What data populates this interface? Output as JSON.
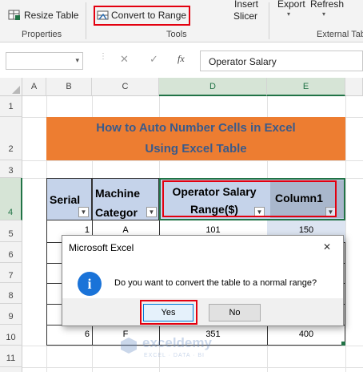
{
  "ribbon": {
    "resize_table": "Resize Table",
    "convert_to_range": "Convert to Range",
    "insert": "Insert",
    "slicer": "Slicer",
    "export": "Export",
    "refresh": "Refresh",
    "group_properties": "Properties",
    "group_tools": "Tools",
    "group_external": "External Tab"
  },
  "formula_bar": {
    "name_box": "",
    "cancel": "✕",
    "enter": "✓",
    "fx": "fx",
    "content": "Operator Salary"
  },
  "columns": [
    "A",
    "B",
    "C",
    "D",
    "E"
  ],
  "rows": [
    "1",
    "2",
    "3",
    "4",
    "5",
    "6",
    "7",
    "8",
    "9",
    "10",
    "11"
  ],
  "sheet": {
    "title": "How to Auto Number Cells in Excel Using Excel Table",
    "headers": {
      "serial": "Serial",
      "machine": "Machine Categor",
      "operator_line1": "Operator Salary",
      "operator_line2": "Range($)",
      "column1": "Column1"
    },
    "row5": {
      "serial": "1",
      "machine": "A",
      "salary": "101",
      "col1": "150"
    },
    "row10": {
      "serial": "6",
      "machine": "F",
      "salary": "351",
      "col1": "400"
    }
  },
  "dialog": {
    "title": "Microsoft Excel",
    "close": "✕",
    "icon_glyph": "i",
    "message": "Do you want to convert the table to a normal range?",
    "yes": "Yes",
    "no": "No"
  },
  "watermark": {
    "name": "exceldemy",
    "tagline": "EXCEL · DATA · BI"
  },
  "colors": {
    "accent_green": "#217346",
    "title_fill": "#ed7d31",
    "header_fill": "#c5d3ea",
    "highlight_red": "#e3000f",
    "info_blue": "#1a73d8"
  }
}
